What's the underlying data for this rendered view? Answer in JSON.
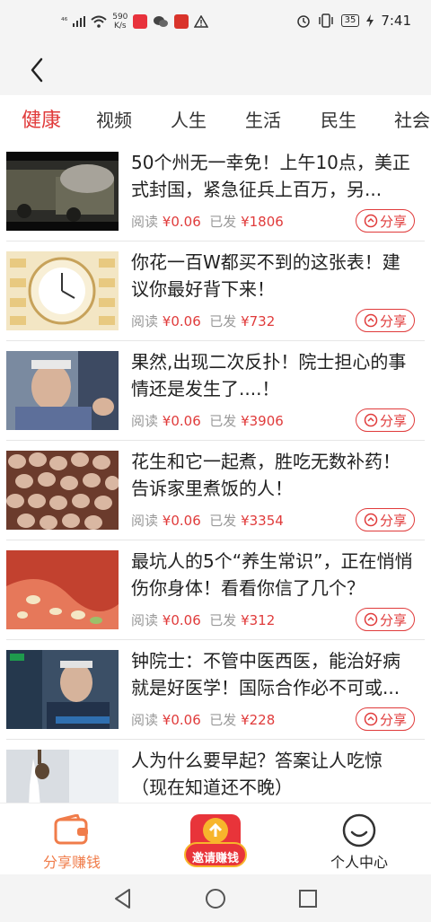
{
  "status_bar": {
    "signal_text": "⁴⁶",
    "net_speed_value": "590",
    "net_speed_unit": "K/s",
    "battery": "35",
    "time": "7:41"
  },
  "tabs": [
    "健康",
    "视频",
    "人生",
    "生活",
    "民生",
    "社会"
  ],
  "articles": [
    {
      "title": "50个州无一幸免！上午10点，美正式封国，紧急征兵上百万，另...",
      "read_label": "阅读",
      "price": "¥0.06",
      "sent_label": "已发",
      "sent_amount": "¥1806",
      "share_label": "分享"
    },
    {
      "title": "你花一百W都买不到的这张表！建议你最好背下来！",
      "read_label": "阅读",
      "price": "¥0.06",
      "sent_label": "已发",
      "sent_amount": "¥732",
      "share_label": "分享"
    },
    {
      "title": "果然,出现二次反扑！院士担心的事情还是发生了....！",
      "read_label": "阅读",
      "price": "¥0.06",
      "sent_label": "已发",
      "sent_amount": "¥3906",
      "share_label": "分享"
    },
    {
      "title": "花生和它一起煮，胜吃无数补药！告诉家里煮饭的人！",
      "read_label": "阅读",
      "price": "¥0.06",
      "sent_label": "已发",
      "sent_amount": "¥3354",
      "share_label": "分享"
    },
    {
      "title": "最坑人的5个“养生常识”，正在悄悄伤你身体！看看你信了几个？",
      "read_label": "阅读",
      "price": "¥0.06",
      "sent_label": "已发",
      "sent_amount": "¥312",
      "share_label": "分享"
    },
    {
      "title": "钟院士：不管中医西医，能治好病就是好医学！国际合作必不可或...",
      "read_label": "阅读",
      "price": "¥0.06",
      "sent_label": "已发",
      "sent_amount": "¥228",
      "share_label": "分享"
    },
    {
      "title": "人为什么要早起？答案让人吃惊（现在知道还不晚）",
      "read_label": "",
      "price": "",
      "sent_label": "",
      "sent_amount": "",
      "share_label": ""
    }
  ],
  "bottom_nav": {
    "share_earn": "分享赚钱",
    "invite_earn": "邀请赚钱",
    "personal_center": "个人中心"
  },
  "colors": {
    "accent": "#e03b3b",
    "orange": "#f07c4a"
  }
}
